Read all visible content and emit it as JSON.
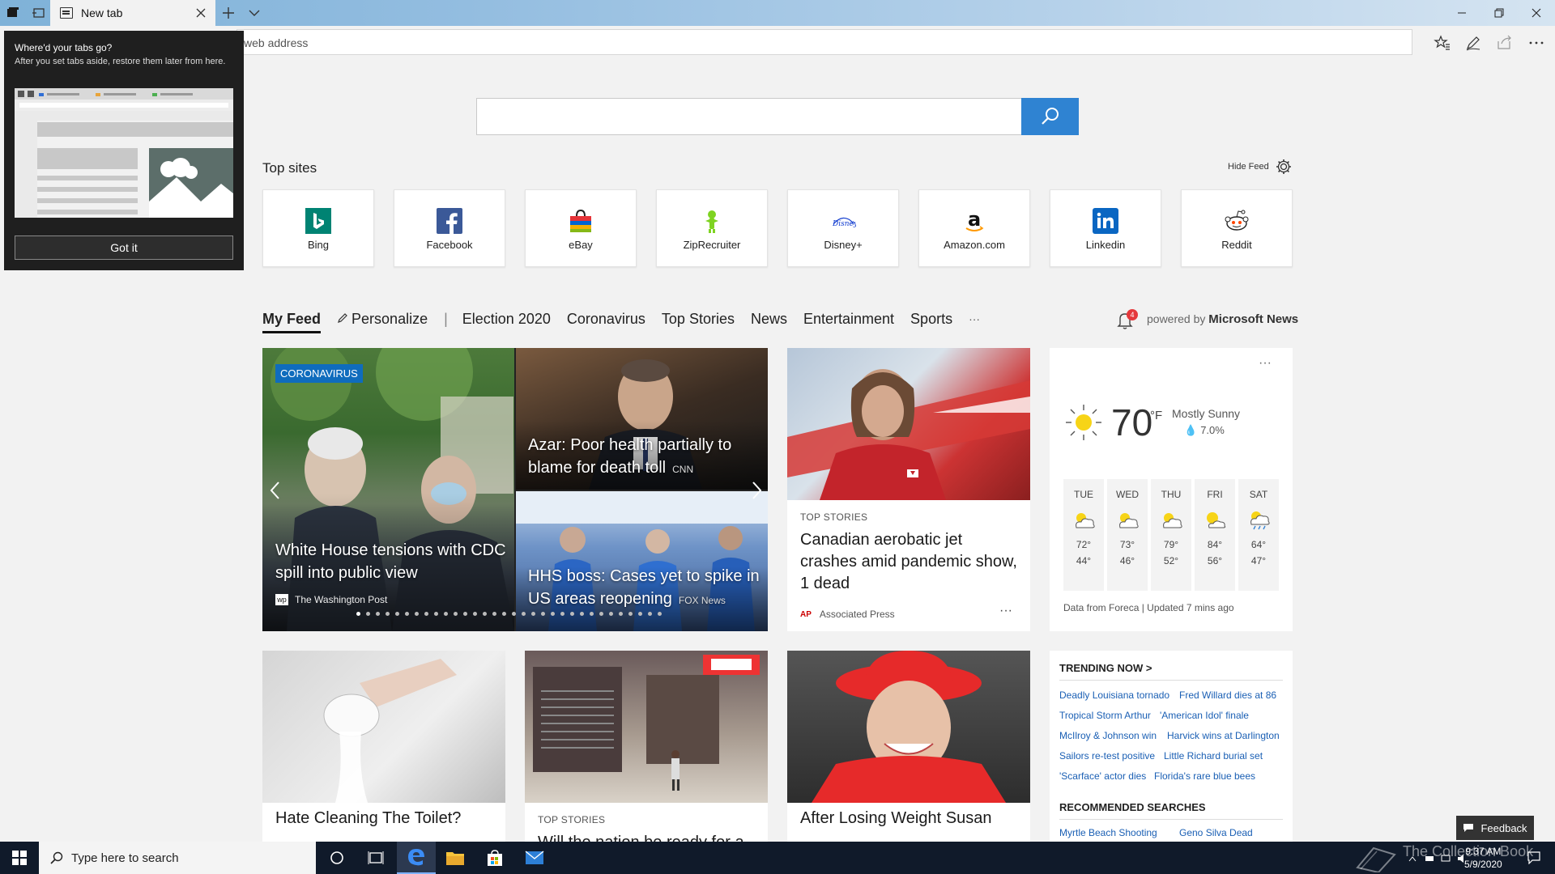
{
  "tabbar": {
    "active_tab_label": "New tab"
  },
  "address": {
    "placeholder": "web address"
  },
  "popup": {
    "title": "Where'd your tabs go?",
    "body": "After you set tabs aside, restore them later from here.",
    "button": "Got it"
  },
  "topsites": {
    "title": "Top sites",
    "hide_feed": "Hide Feed",
    "tiles": [
      {
        "label": "Bing"
      },
      {
        "label": "Facebook"
      },
      {
        "label": "eBay"
      },
      {
        "label": "ZipRecruiter"
      },
      {
        "label": "Disney+"
      },
      {
        "label": "Amazon.com"
      },
      {
        "label": "Linkedin"
      },
      {
        "label": "Reddit"
      }
    ]
  },
  "feed": {
    "nav": [
      "My Feed",
      "Personalize",
      "Election 2020",
      "Coronavirus",
      "Top Stories",
      "News",
      "Entertainment",
      "Sports",
      "···"
    ],
    "notifications": "4",
    "powered_prefix": "powered by",
    "powered_brand": "Microsoft News"
  },
  "hero": {
    "badge": "CORONAVIRUS",
    "main_title": "White House tensions with CDC spill into public view",
    "main_source": "The Washington Post",
    "top_title": "Azar: Poor health partially to blame for death toll",
    "top_source": "CNN",
    "bottom_title": "HHS boss: Cases yet to spike in US areas reopening",
    "bottom_source": "FOX News"
  },
  "story1": {
    "kicker": "TOP STORIES",
    "title": "Canadian aerobatic jet crashes amid pandemic show, 1 dead",
    "source": "Associated Press",
    "more": "···"
  },
  "weather": {
    "temp": "70",
    "unit": "°F",
    "condition": "Mostly Sunny",
    "precip": "7.0%",
    "more": "···",
    "days": [
      {
        "day": "TUE",
        "hi": "72°",
        "lo": "44°"
      },
      {
        "day": "WED",
        "hi": "73°",
        "lo": "46°"
      },
      {
        "day": "THU",
        "hi": "79°",
        "lo": "52°"
      },
      {
        "day": "FRI",
        "hi": "84°",
        "lo": "56°"
      },
      {
        "day": "SAT",
        "hi": "64°",
        "lo": "47°"
      }
    ],
    "footer": "Data from Foreca | Updated 7 mins ago"
  },
  "row2": {
    "card1_title": "Hate Cleaning The Toilet?",
    "card2_kicker": "TOP STORIES",
    "card2_title": "Will the nation be ready for a",
    "card3_title": "After Losing Weight Susan"
  },
  "trending": {
    "heading": "TRENDING NOW >",
    "links": [
      "Deadly Louisiana tornado",
      "Fred Willard dies at 86",
      "Tropical Storm Arthur",
      "'American Idol' finale",
      "McIlroy & Johnson win",
      "Harvick wins at Darlington",
      "Sailors re-test positive",
      "Little Richard burial set",
      "'Scarface' actor dies",
      "Florida's rare blue bees"
    ],
    "rec_heading": "RECOMMENDED SEARCHES",
    "rec_links": [
      "Myrtle Beach Shooting",
      "Geno Silva Dead"
    ]
  },
  "feedback": "Feedback",
  "taskbar": {
    "search_placeholder": "Type here to search",
    "time": "9:37 AM",
    "date": "5/9/2020",
    "watermark": "The Collection Book"
  }
}
